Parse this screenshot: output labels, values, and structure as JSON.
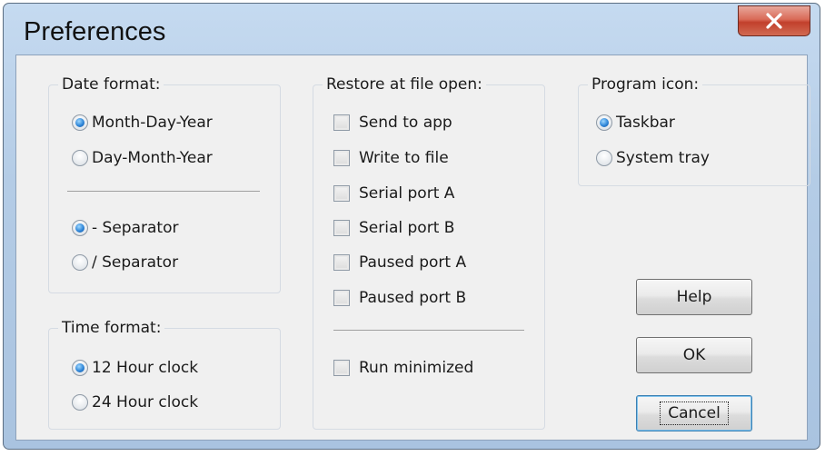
{
  "window": {
    "title": "Preferences"
  },
  "colors": {
    "accent": "#2f86d8",
    "close": "#c2402c"
  },
  "date_format": {
    "label": "Date format:",
    "order_options": [
      {
        "label": "Month-Day-Year",
        "checked": true
      },
      {
        "label": "Day-Month-Year",
        "checked": false
      }
    ],
    "separator_options": [
      {
        "label": "- Separator",
        "checked": true
      },
      {
        "label": "/ Separator",
        "checked": false
      }
    ]
  },
  "time_format": {
    "label": "Time format:",
    "options": [
      {
        "label": "12 Hour clock",
        "checked": true
      },
      {
        "label": "24 Hour clock",
        "checked": false
      }
    ]
  },
  "restore": {
    "label": "Restore at file open:",
    "options": [
      {
        "label": "Send to app",
        "checked": false
      },
      {
        "label": "Write to file",
        "checked": false
      },
      {
        "label": "Serial port A",
        "checked": false
      },
      {
        "label": "Serial port B",
        "checked": false
      },
      {
        "label": "Paused port A",
        "checked": false
      },
      {
        "label": "Paused port B",
        "checked": false
      }
    ],
    "run_minimized": {
      "label": "Run minimized",
      "checked": false
    }
  },
  "program_icon": {
    "label": "Program icon:",
    "options": [
      {
        "label": "Taskbar",
        "checked": true
      },
      {
        "label": "System tray",
        "checked": false
      }
    ]
  },
  "buttons": {
    "help": "Help",
    "ok": "OK",
    "cancel": "Cancel"
  }
}
